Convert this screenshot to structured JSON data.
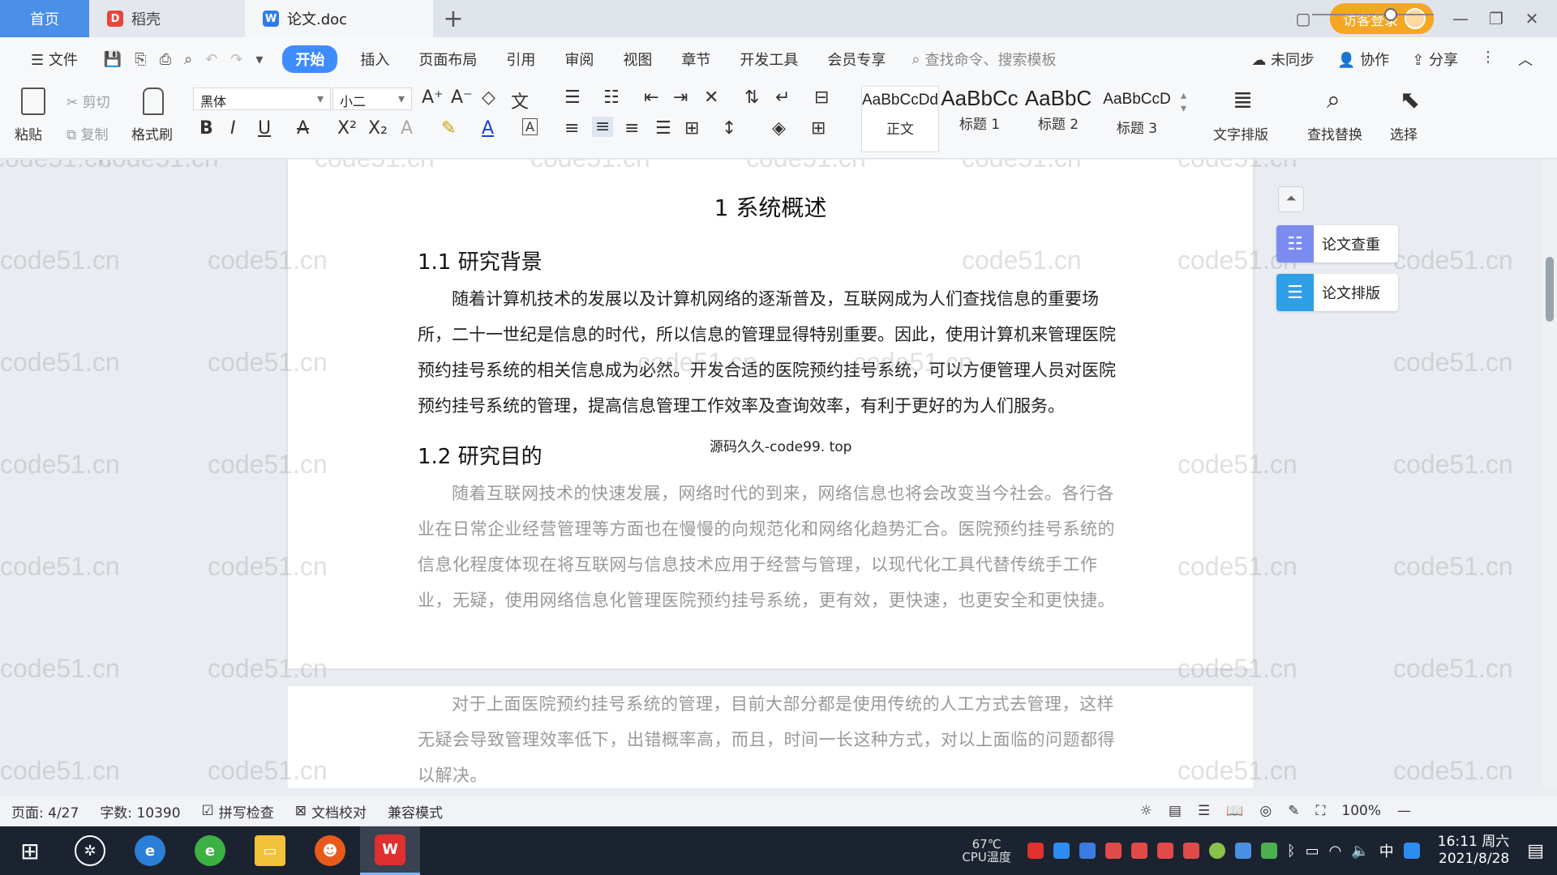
{
  "tabs": [
    {
      "label": "首页"
    },
    {
      "label": "稻壳"
    },
    {
      "label": "论文.doc"
    }
  ],
  "header": {
    "login_label": "访客登录"
  },
  "menu": {
    "file": "文件",
    "items": [
      "开始",
      "插入",
      "页面布局",
      "引用",
      "审阅",
      "视图",
      "章节",
      "开发工具",
      "会员专享"
    ],
    "search_placeholder": "查找命令、搜索模板",
    "right": [
      "未同步",
      "协作",
      "分享"
    ]
  },
  "ribbon": {
    "paste": "粘贴",
    "cut": "剪切",
    "copy": "复制",
    "format_painter": "格式刷",
    "font_name": "黑体",
    "font_size": "小二",
    "styles": [
      {
        "sample": "AaBbCcDd",
        "name": "正文"
      },
      {
        "sample": "AaBbCc",
        "name": "标题 1"
      },
      {
        "sample": "AaBbC",
        "name": "标题 2"
      },
      {
        "sample": "AaBbCcD",
        "name": "标题 3"
      }
    ],
    "text_layout": "文字排版",
    "find_replace": "查找替换",
    "select": "选择"
  },
  "document": {
    "h1": "1 系统概述",
    "s1_title": "1.1  研究背景",
    "s1_para": "随着计算机技术的发展以及计算机网络的逐渐普及，互联网成为人们查找信息的重要场所，二十一世纪是信息的时代，所以信息的管理显得特别重要。因此，使用计算机来管理医院预约挂号系统的相关信息成为必然。开发合适的医院预约挂号系统，可以方便管理人员对医院预约挂号系统的管理，提高信息管理工作效率及查询效率，有利于更好的为人们服务。",
    "overlay_text": "源码久久-code99. top",
    "s2_title": "1.2 研究目的",
    "s2_para": "随着互联网技术的快速发展，网络时代的到来，网络信息也将会改变当今社会。各行各业在日常企业经营管理等方面也在慢慢的向规范化和网络化趋势汇合。医院预约挂号系统的信息化程度体现在将互联网与信息技术应用于经营与管理，以现代化工具代替传统手工作业，无疑，使用网络信息化管理医院预约挂号系统，更有效，更快速，也更安全和更快捷。",
    "s2_para2": "对于上面医院预约挂号系统的管理，目前大部分都是使用传统的人工方式去管理，这样无疑会导致管理效率低下，出错概率高，而且，时间一长这种方式，对以上面临的问题都得以解决。",
    "watermark": "code51.cn"
  },
  "side_panel": {
    "check": "论文查重",
    "layout": "论文排版"
  },
  "status": {
    "page": "页面: 4/27",
    "words": "字数: 10390",
    "spell": "拼写检查",
    "proof": "文档校对",
    "compat": "兼容模式",
    "zoom": "100%",
    "zoom_level": 0.5
  },
  "taskbar": {
    "cpu_temp": "67℃",
    "cpu_label": "CPU温度",
    "ime": "中",
    "time": "16:11 周六",
    "date": "2021/8/28"
  },
  "colors": {
    "accent": "#3f8cff",
    "home_tab": "#4a8fe8",
    "login": "#f5a623",
    "taskbar": "#1c2330"
  }
}
